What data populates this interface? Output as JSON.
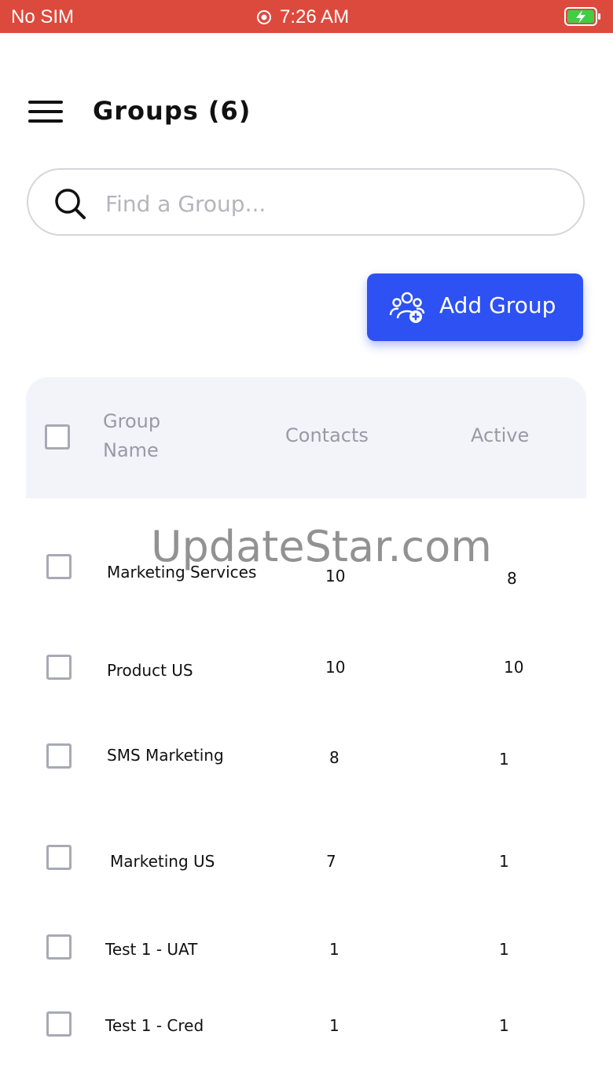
{
  "status_bar": {
    "carrier": "No SIM",
    "time": "7:26 AM",
    "battery_color": "#44cc44",
    "background": "#dc4a3d"
  },
  "header": {
    "title": "Groups (6)",
    "menu_icon": "hamburger-menu-icon"
  },
  "search": {
    "placeholder": "Find a Group...",
    "value": "",
    "icon": "search-icon"
  },
  "actions": {
    "add_group_label": "Add Group",
    "add_group_icon": "group-add-icon",
    "accent_color": "#2d51f2"
  },
  "table": {
    "columns": {
      "group_name": "Group Name",
      "contacts": "Contacts",
      "active": "Active"
    },
    "rows": [
      {
        "name": "Marketing Services",
        "contacts": "10",
        "active": "8"
      },
      {
        "name": "Product US",
        "contacts": "10",
        "active": "10"
      },
      {
        "name": "SMS Marketing",
        "contacts": "8",
        "active": "1"
      },
      {
        "name": "Marketing US",
        "contacts": "7",
        "active": "1"
      },
      {
        "name": "Test 1 - UAT",
        "contacts": "1",
        "active": "1"
      },
      {
        "name": "Test 1 - Cred",
        "contacts": "1",
        "active": "1"
      }
    ]
  },
  "watermark": "UpdateStar.com"
}
